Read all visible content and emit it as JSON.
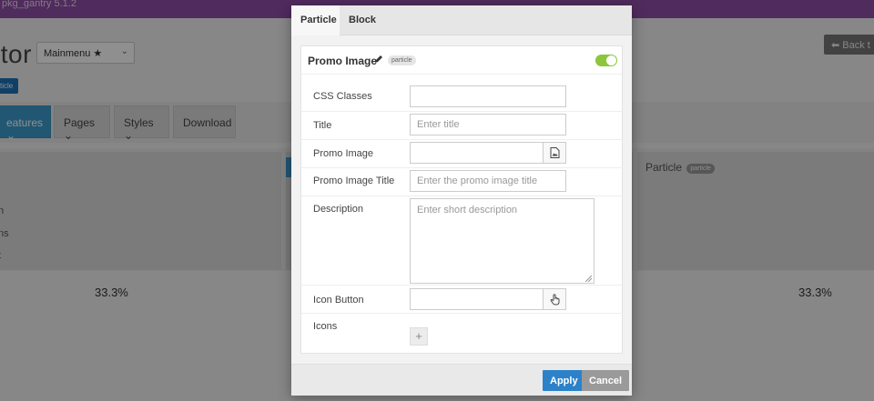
{
  "background": {
    "topbar_text": "  pkg_gantry 5.1.2",
    "page_title": "itor",
    "menu_select": "Mainmenu ★",
    "back_button": "Back t",
    "small_badge": "ticle",
    "nav": [
      "eatures",
      "Pages",
      "Styles",
      "Download"
    ],
    "left_items": [
      "n",
      "ns",
      "t"
    ],
    "particle_label": "Particle",
    "particle_tag": "particle",
    "percent_left": "33.3%",
    "percent_right": "33.3%"
  },
  "modal": {
    "tabs": [
      "Particle",
      "Block"
    ],
    "panel": {
      "title": "Promo Image",
      "badge": "particle",
      "enabled": true,
      "fields": {
        "css_classes": {
          "label": "CSS Classes",
          "value": "",
          "placeholder": ""
        },
        "title": {
          "label": "Title",
          "value": "",
          "placeholder": "Enter title"
        },
        "promo_image": {
          "label": "Promo Image",
          "value": "",
          "placeholder": ""
        },
        "promo_image_title": {
          "label": "Promo Image Title",
          "value": "",
          "placeholder": "Enter the promo image title"
        },
        "description": {
          "label": "Description",
          "value": "",
          "placeholder": "Enter short description"
        },
        "icon_button": {
          "label": "Icon Button",
          "value": "",
          "placeholder": ""
        },
        "icons": {
          "label": "Icons",
          "add_label": "+"
        }
      }
    },
    "footer": {
      "apply": "Apply",
      "cancel": "Cancel"
    }
  },
  "icons": {
    "pencil": "pencil-icon",
    "image_picker": "image-file-icon",
    "icon_picker": "hand-pointer-icon",
    "back": "arrow-left-icon",
    "dropdown": "caret-down-icon"
  },
  "colors": {
    "topbar": "#8f4ea6",
    "accent": "#3d9ccd",
    "apply": "#2c82c9",
    "toggle_on": "#8cc63e"
  }
}
